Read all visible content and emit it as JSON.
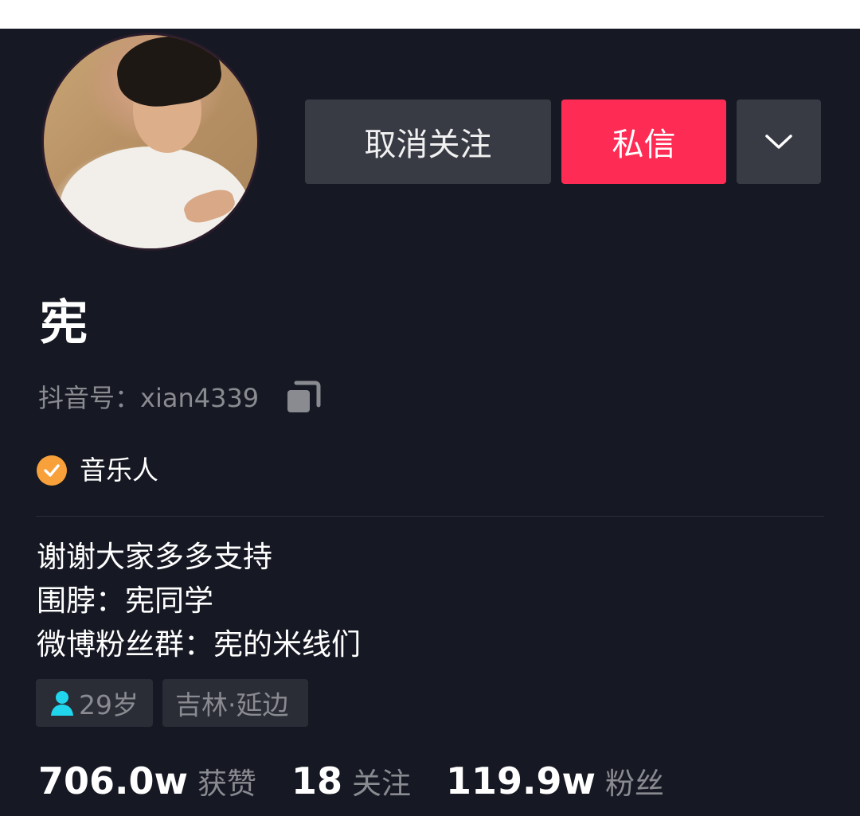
{
  "profile": {
    "nickname": "宪",
    "douyin_id": "抖音号：xian4339",
    "verification": "音乐人",
    "bio": [
      "谢谢大家多多支持",
      "围脖：宪同学",
      "微博粉丝群：宪的米线们"
    ],
    "tags": {
      "age": "29岁",
      "location": "吉林·延边"
    }
  },
  "actions": {
    "unfollow": "取消关注",
    "message": "私信",
    "more_icon": "chevron-down-icon"
  },
  "stats": {
    "likes": {
      "value": "706.0w",
      "label": "获赞"
    },
    "following": {
      "value": "18",
      "label": "关注"
    },
    "followers": {
      "value": "119.9w",
      "label": "粉丝"
    }
  },
  "colors": {
    "background": "#161823",
    "accent": "#fe2c55",
    "button_gray": "#393b44",
    "badge": "#f8a13a",
    "age_icon": "#20d5ec",
    "muted_text": "#8a8b91"
  }
}
